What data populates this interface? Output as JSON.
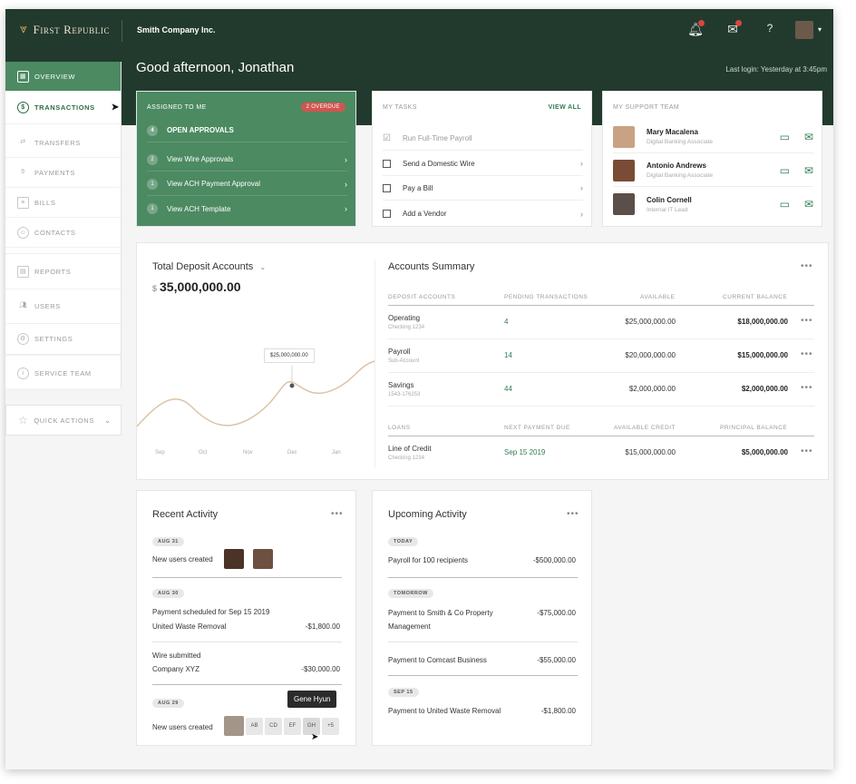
{
  "header": {
    "logo_text": "First Republic",
    "company": "Smith Company Inc.",
    "help": "?",
    "greeting": "Good afternoon, Jonathan",
    "last_login": "Last login: Yesterday at 3:45pm"
  },
  "sidebar": {
    "items": [
      {
        "label": "OVERVIEW",
        "icon": "grid-icon"
      },
      {
        "label": "TRANSACTIONS",
        "icon": "dollar-icon"
      },
      {
        "label": "TRANSFERS",
        "icon": "transfer-icon"
      },
      {
        "label": "PAYMENTS",
        "icon": "hand-icon"
      },
      {
        "label": "BILLS",
        "icon": "bill-icon"
      },
      {
        "label": "CONTACTS",
        "icon": "contact-icon"
      },
      {
        "label": "REPORTS",
        "icon": "report-icon"
      },
      {
        "label": "USERS",
        "icon": "users-icon"
      },
      {
        "label": "SETTINGS",
        "icon": "settings-icon"
      },
      {
        "label": "SERVICE TEAM",
        "icon": "service-icon"
      }
    ],
    "quick_actions": "QUICK ACTIONS"
  },
  "assigned": {
    "title": "ASSIGNED TO ME",
    "badge": "2 OVERDUE",
    "items": [
      {
        "num": "4",
        "label": "OPEN APPROVALS"
      },
      {
        "num": "2",
        "label": "View Wire Approvals"
      },
      {
        "num": "1",
        "label": "View ACH Payment Approval"
      },
      {
        "num": "1",
        "label": "View ACH Template"
      }
    ]
  },
  "tasks": {
    "title": "MY TASKS",
    "view_all": "VIEW ALL",
    "items": [
      {
        "label": "Run Full-Time Payroll"
      },
      {
        "label": "Send a Domestic Wire"
      },
      {
        "label": "Pay a Bill"
      },
      {
        "label": "Add a Vendor"
      }
    ]
  },
  "support": {
    "title": "MY SUPPORT TEAM",
    "members": [
      {
        "name": "Mary Macalena",
        "role": "Digital Banking Associate"
      },
      {
        "name": "Antonio Andrews",
        "role": "Digital Banking Associate"
      },
      {
        "name": "Colin Cornell",
        "role": "Internal IT Lead"
      }
    ]
  },
  "deposit": {
    "title": "Total Deposit Accounts",
    "currency": "$",
    "amount": "35,000,000.00",
    "tooltip": "$25,000,000.00",
    "months": [
      "Sep",
      "Oct",
      "Nov",
      "Dec",
      "Jan"
    ]
  },
  "summary": {
    "title": "Accounts Summary",
    "more": "•••",
    "deposit_headers": [
      "DEPOSIT ACCOUNTS",
      "PENDING TRANSACTIONS",
      "AVAILABLE",
      "CURRENT BALANCE"
    ],
    "deposit_rows": [
      {
        "name": "Operating",
        "sub": "Checking 1234",
        "pending": "4",
        "available": "$25,000,000.00",
        "balance": "$18,000,000.00"
      },
      {
        "name": "Payroll",
        "sub": "Sub-Account",
        "pending": "14",
        "available": "$20,000,000.00",
        "balance": "$15,000,000.00"
      },
      {
        "name": "Savings",
        "sub": "1543-176253",
        "pending": "44",
        "available": "$2,000,000.00",
        "balance": "$2,000,000.00"
      }
    ],
    "loan_headers": [
      "LOANS",
      "NEXT PAYMENT DUE",
      "AVAILABLE CREDIT",
      "PRINCIPAL BALANCE"
    ],
    "loan_rows": [
      {
        "name": "Line of Credit",
        "sub": "Checking 1234",
        "due": "Sep 15 2019",
        "credit": "$15,000,000.00",
        "principal": "$5,000,000.00"
      }
    ]
  },
  "recent": {
    "title": "Recent Activity",
    "more": "•••",
    "d1": "AUG 31",
    "t1": "New users created",
    "d2": "AUG 30",
    "t2a": "Payment scheduled for Sep 15 2019",
    "t2b": "United Waste Removal",
    "a2": "-$1,800.00",
    "t3a": "Wire submitted",
    "t3b": "Company XYZ",
    "a3": "-$30,000.00",
    "d3": "AUG 29",
    "t4": "New users created",
    "initials": [
      "AB",
      "CD",
      "EF",
      "GH",
      "+5"
    ],
    "tooltip": "Gene Hyun"
  },
  "upcoming": {
    "title": "Upcoming Activity",
    "more": "•••",
    "d1": "TODAY",
    "t1": "Payroll for 100 recipients",
    "a1": "-$500,000.00",
    "d2": "TOMORROW",
    "t2a": "Payment to Smith & Co Property",
    "t2b": "Management",
    "a2": "-$75,000.00",
    "t3": "Payment to Comcast Business",
    "a3": "-$55,000.00",
    "d3": "SEP 15",
    "t4": "Payment to United Waste Removal",
    "a4": "-$1,800.00"
  },
  "colors": {
    "brand_dark": "#223a2d",
    "accent_green": "#4c8a62",
    "alert_red": "#d3544f"
  }
}
